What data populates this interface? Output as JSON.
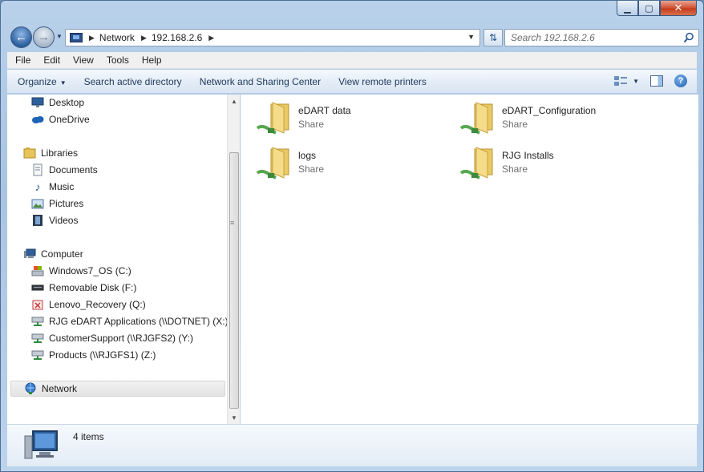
{
  "window": {
    "minimize_label": "▁",
    "maximize_label": "▢",
    "close_label": "✕"
  },
  "address": {
    "segments": [
      "Network",
      "192.168.2.6"
    ],
    "search_placeholder": "Search 192.168.2.6"
  },
  "menu": {
    "items": [
      "File",
      "Edit",
      "View",
      "Tools",
      "Help"
    ]
  },
  "toolbar": {
    "organize": "Organize",
    "search_ad": "Search active directory",
    "network_center": "Network and Sharing Center",
    "remote_printers": "View remote printers",
    "help": "?"
  },
  "nav_pane": {
    "favorites": [
      {
        "label": "Desktop",
        "icon": "desktop-icon"
      },
      {
        "label": "OneDrive",
        "icon": "onedrive-icon"
      }
    ],
    "libraries_label": "Libraries",
    "libraries": [
      {
        "label": "Documents",
        "icon": "documents-icon"
      },
      {
        "label": "Music",
        "icon": "music-icon"
      },
      {
        "label": "Pictures",
        "icon": "pictures-icon"
      },
      {
        "label": "Videos",
        "icon": "videos-icon"
      }
    ],
    "computer_label": "Computer",
    "drives": [
      {
        "label": "Windows7_OS (C:)",
        "icon": "local-disk-icon"
      },
      {
        "label": "Removable Disk (F:)",
        "icon": "removable-disk-icon"
      },
      {
        "label": "Lenovo_Recovery (Q:)",
        "icon": "recovery-disk-icon"
      },
      {
        "label": "RJG eDART Applications (\\\\DOTNET) (X:)",
        "icon": "network-drive-icon"
      },
      {
        "label": "CustomerSupport (\\\\RJGFS2) (Y:)",
        "icon": "network-drive-icon"
      },
      {
        "label": "Products (\\\\RJGFS1) (Z:)",
        "icon": "network-drive-icon"
      }
    ],
    "network_label": "Network"
  },
  "shares": [
    {
      "name": "eDART data",
      "type": "Share"
    },
    {
      "name": "eDART_Configuration",
      "type": "Share"
    },
    {
      "name": "logs",
      "type": "Share"
    },
    {
      "name": "RJG Installs",
      "type": "Share"
    }
  ],
  "details": {
    "item_count": "4 items"
  }
}
